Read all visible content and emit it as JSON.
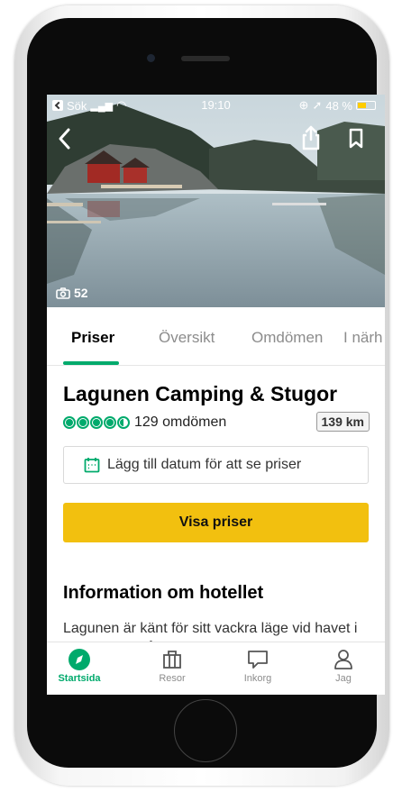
{
  "status_bar": {
    "back_label": "Sök",
    "time": "19:10",
    "battery_percent": "48 %",
    "battery_level": 0.48
  },
  "hero": {
    "photo_count": "52"
  },
  "tabs": [
    {
      "label": "Priser"
    },
    {
      "label": "Översikt"
    },
    {
      "label": "Omdömen"
    },
    {
      "label": "I närh"
    }
  ],
  "hotel": {
    "name": "Lagunen Camping & Stugor",
    "rating": 4.5,
    "review_count": "129 omdömen",
    "distance": "139 km"
  },
  "date_picker": {
    "label": "Lägg till datum för att se priser"
  },
  "cta": {
    "label": "Visa priser"
  },
  "info": {
    "title": "Information om hotellet",
    "description": "Lagunen är känt för sitt vackra läge vid havet i Bohuslän. Två bermyäling"
  },
  "bottom_nav": [
    {
      "label": "Startsida"
    },
    {
      "label": "Resor"
    },
    {
      "label": "Inkorg"
    },
    {
      "label": "Jag"
    }
  ],
  "colors": {
    "accent": "#00aa6c",
    "cta": "#f2c00f"
  }
}
